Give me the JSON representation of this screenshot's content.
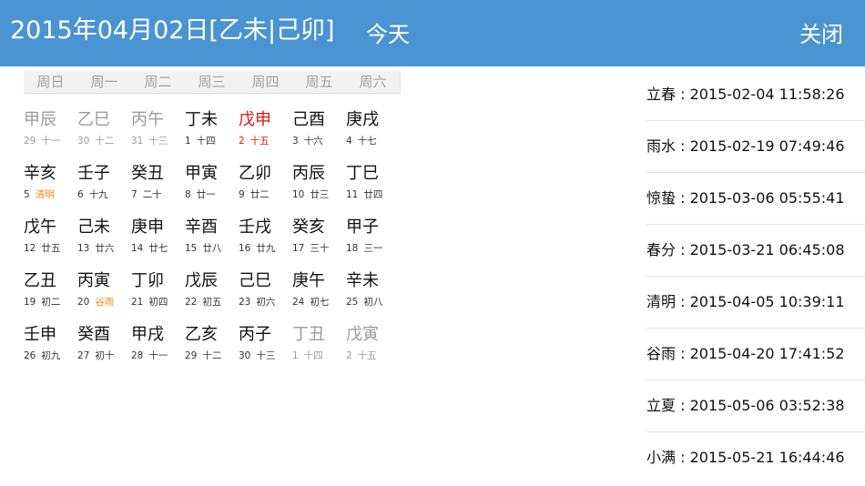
{
  "header": {
    "title": "2015年04月02日[乙未|己卯]",
    "today_label": "今天",
    "close_label": "关闭"
  },
  "weekdays": [
    "周日",
    "周一",
    "周二",
    "周三",
    "周四",
    "周五",
    "周六"
  ],
  "calendar": [
    [
      {
        "gz": "甲辰",
        "day": "29",
        "lunar": "十一",
        "state": "dim"
      },
      {
        "gz": "乙巳",
        "day": "30",
        "lunar": "十二",
        "state": "dim"
      },
      {
        "gz": "丙午",
        "day": "31",
        "lunar": "十三",
        "state": "dim"
      },
      {
        "gz": "丁未",
        "day": "1",
        "lunar": "十四",
        "state": "normal"
      },
      {
        "gz": "戊申",
        "day": "2",
        "lunar": "十五",
        "state": "today"
      },
      {
        "gz": "己酉",
        "day": "3",
        "lunar": "十六",
        "state": "normal"
      },
      {
        "gz": "庚戌",
        "day": "4",
        "lunar": "十七",
        "state": "normal"
      }
    ],
    [
      {
        "gz": "辛亥",
        "day": "5",
        "lunar": "清明",
        "state": "normal",
        "term": true
      },
      {
        "gz": "壬子",
        "day": "6",
        "lunar": "十九",
        "state": "normal"
      },
      {
        "gz": "癸丑",
        "day": "7",
        "lunar": "二十",
        "state": "normal"
      },
      {
        "gz": "甲寅",
        "day": "8",
        "lunar": "廿一",
        "state": "normal"
      },
      {
        "gz": "乙卯",
        "day": "9",
        "lunar": "廿二",
        "state": "normal"
      },
      {
        "gz": "丙辰",
        "day": "10",
        "lunar": "廿三",
        "state": "normal"
      },
      {
        "gz": "丁巳",
        "day": "11",
        "lunar": "廿四",
        "state": "normal"
      }
    ],
    [
      {
        "gz": "戊午",
        "day": "12",
        "lunar": "廿五",
        "state": "normal"
      },
      {
        "gz": "己未",
        "day": "13",
        "lunar": "廿六",
        "state": "normal"
      },
      {
        "gz": "庚申",
        "day": "14",
        "lunar": "廿七",
        "state": "normal"
      },
      {
        "gz": "辛酉",
        "day": "15",
        "lunar": "廿八",
        "state": "normal"
      },
      {
        "gz": "壬戌",
        "day": "16",
        "lunar": "廿九",
        "state": "normal"
      },
      {
        "gz": "癸亥",
        "day": "17",
        "lunar": "三十",
        "state": "normal"
      },
      {
        "gz": "甲子",
        "day": "18",
        "lunar": "三一",
        "state": "normal"
      }
    ],
    [
      {
        "gz": "乙丑",
        "day": "19",
        "lunar": "初二",
        "state": "normal"
      },
      {
        "gz": "丙寅",
        "day": "20",
        "lunar": "谷雨",
        "state": "normal",
        "term": true
      },
      {
        "gz": "丁卯",
        "day": "21",
        "lunar": "初四",
        "state": "normal"
      },
      {
        "gz": "戊辰",
        "day": "22",
        "lunar": "初五",
        "state": "normal"
      },
      {
        "gz": "己巳",
        "day": "23",
        "lunar": "初六",
        "state": "normal"
      },
      {
        "gz": "庚午",
        "day": "24",
        "lunar": "初七",
        "state": "normal"
      },
      {
        "gz": "辛未",
        "day": "25",
        "lunar": "初八",
        "state": "normal"
      }
    ],
    [
      {
        "gz": "壬申",
        "day": "26",
        "lunar": "初九",
        "state": "normal"
      },
      {
        "gz": "癸酉",
        "day": "27",
        "lunar": "初十",
        "state": "normal"
      },
      {
        "gz": "甲戌",
        "day": "28",
        "lunar": "十一",
        "state": "normal"
      },
      {
        "gz": "乙亥",
        "day": "29",
        "lunar": "十二",
        "state": "normal"
      },
      {
        "gz": "丙子",
        "day": "30",
        "lunar": "十三",
        "state": "normal"
      },
      {
        "gz": "丁丑",
        "day": "1",
        "lunar": "十四",
        "state": "dim"
      },
      {
        "gz": "戊寅",
        "day": "2",
        "lunar": "十五",
        "state": "dim"
      }
    ]
  ],
  "solar_terms": [
    "立春 : 2015-02-04 11:58:26",
    "雨水 : 2015-02-19 07:49:46",
    "惊蛰 : 2015-03-06 05:55:41",
    "春分 : 2015-03-21 06:45:08",
    "清明 : 2015-04-05 10:39:11",
    "谷雨 : 2015-04-20 17:41:52",
    "立夏 : 2015-05-06 03:52:38",
    "小满 : 2015-05-21 16:44:46"
  ],
  "colors": {
    "header_bg": "#4a94d2",
    "today": "#e11414",
    "solar_term_label": "#ef8a1f",
    "dim": "#9b9b9b"
  }
}
